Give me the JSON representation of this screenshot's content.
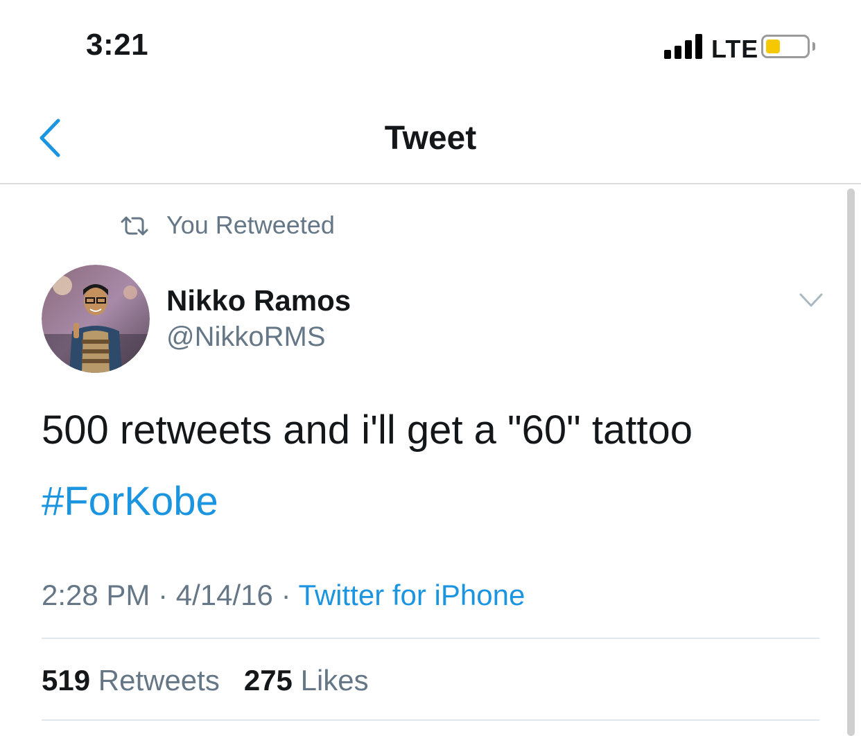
{
  "status_bar": {
    "time": "3:21",
    "network": "LTE",
    "battery_level": 0.2,
    "battery_color": "#f5c800"
  },
  "nav": {
    "title": "Tweet",
    "back_icon": "chevron-left-icon"
  },
  "tweet": {
    "retweet_label": "You Retweeted",
    "author_name": "Nikko Ramos",
    "author_handle": "@NikkoRMS",
    "text": "500 retweets and i'll get a \"60\" tattoo",
    "hashtag": "#ForKobe",
    "time": "2:28 PM",
    "date": "4/14/16",
    "separator": "·",
    "source": "Twitter for iPhone",
    "retweets_count": "519",
    "retweets_label": "Retweets",
    "likes_count": "275",
    "likes_label": "Likes"
  },
  "colors": {
    "accent": "#1b95e0",
    "secondary_text": "#657786",
    "primary_text": "#14171a"
  }
}
